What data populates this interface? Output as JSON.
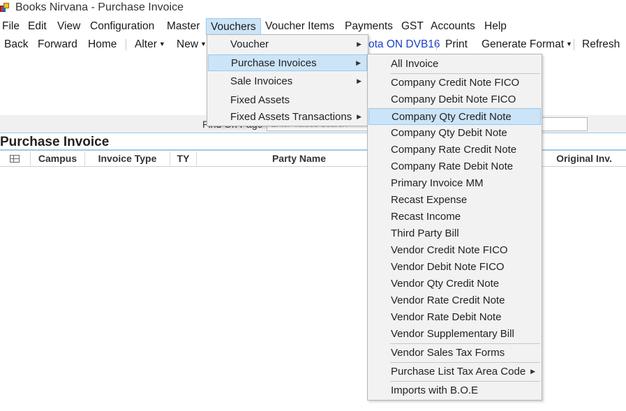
{
  "window": {
    "title": "Books Nirvana - Purchase Invoice"
  },
  "menubar": {
    "items": [
      "File",
      "Edit",
      "View",
      "Configuration",
      "Master",
      "Vouchers",
      "Voucher Items",
      "Payments",
      "GST",
      "Accounts",
      "Help"
    ],
    "active": "Vouchers"
  },
  "toolbar": {
    "back": "Back",
    "forward": "Forward",
    "home": "Home",
    "alter": "Alter",
    "new": "New",
    "voucher_link": "ota ON DVB16",
    "print": "Print",
    "generate_format": "Generate Format",
    "refresh": "Refresh"
  },
  "find": {
    "label": "Find On Page",
    "placeholder": "Enter Values Search"
  },
  "section": {
    "title": "Purchase Invoice"
  },
  "grid": {
    "columns": [
      "Campus",
      "Invoice Type",
      "TY",
      "Party Name",
      "Original Inv."
    ]
  },
  "vouchers_menu": {
    "items": [
      {
        "label": "Voucher",
        "submenu": true
      },
      {
        "label": "Purchase Invoices",
        "submenu": true,
        "highlighted": true
      },
      {
        "label": "Sale Invoices",
        "submenu": true
      },
      {
        "label": "Fixed Assets",
        "submenu": false
      },
      {
        "label": "Fixed Assets Transactions",
        "submenu": true
      }
    ]
  },
  "purchase_invoices_menu": {
    "items": [
      "All Invoice",
      "Company Credit Note FICO",
      "Company Debit Note FICO",
      "Company Qty Credit Note",
      "Company Qty Debit Note",
      "Company Rate Credit Note",
      "Company Rate Debit Note",
      "Primary Invoice MM",
      "Recast Expense",
      "Recast Income",
      "Third Party Bill",
      "Vendor Credit Note FICO",
      "Vendor Debit Note FICO",
      "Vendor Qty Credit Note",
      "Vendor Rate Credit Note",
      "Vendor Rate Debit Note",
      "Vendor Supplementary Bill",
      "Vendor Sales Tax Forms",
      "Purchase List Tax Area Code",
      "Imports with B.O.E"
    ],
    "highlighted": "Company Qty Credit Note"
  },
  "icons": {
    "app": "app-icon",
    "submenu_arrow": "submenu-arrow-icon",
    "grid_menu": "grid-menu-icon",
    "dropdown_caret": "dropdown-caret-icon"
  },
  "colors": {
    "highlight": "#cce4f7",
    "highlight_border": "#99c9ef",
    "link": "#1a3fc7",
    "rule": "#9ec9e8"
  }
}
